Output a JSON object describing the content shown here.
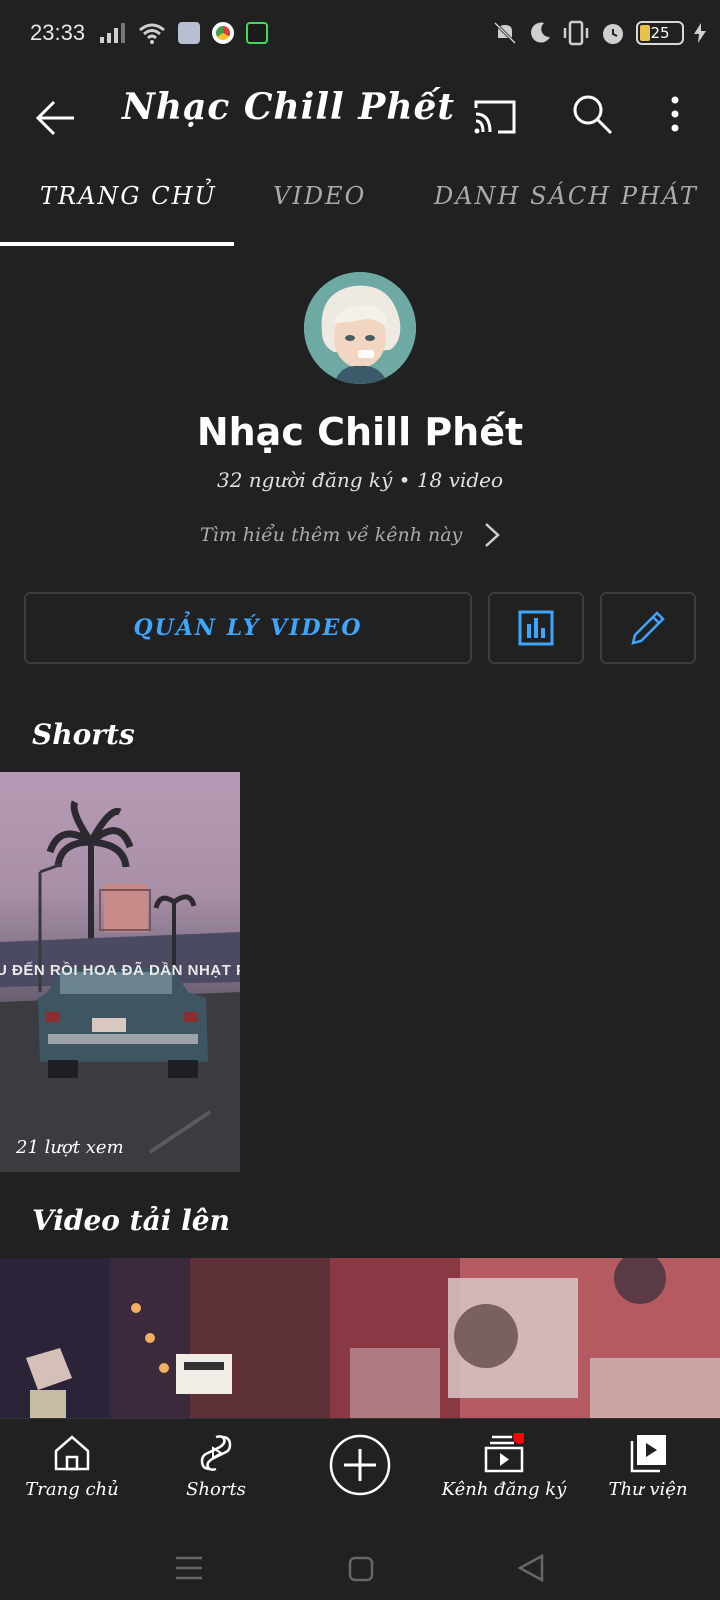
{
  "status_bar": {
    "time": "23:33",
    "battery_level": "25",
    "icons": [
      "signal-icon",
      "wifi-icon",
      "app-notification-icon",
      "chrome-icon",
      "app-icon",
      "mute-icon",
      "moon-icon",
      "vibrate-icon",
      "alarm-icon",
      "battery-icon",
      "charging-icon"
    ]
  },
  "appbar": {
    "title": "Nhạc Chill Phết"
  },
  "tabs": [
    {
      "label": "TRANG CHỦ",
      "active": true
    },
    {
      "label": "VIDEO",
      "active": false
    },
    {
      "label": "DANH SÁCH PHÁT",
      "active": false
    }
  ],
  "channel": {
    "name": "Nhạc Chill Phết",
    "stats": "32 người đăng ký • 18 video",
    "learn_more": "Tìm hiểu thêm về kênh này"
  },
  "actions": {
    "manage_label": "QUẢN LÝ VIDEO"
  },
  "shorts": {
    "title": "Shorts",
    "items": [
      {
        "views": "21 lượt xem",
        "overlay_text": "U ĐẾN RỒI HOA ĐÃ DẦN NHẠT P"
      }
    ]
  },
  "uploads": {
    "title": "Video tải lên"
  },
  "bottom_nav": [
    {
      "label": "Trang chủ",
      "icon": "home-icon"
    },
    {
      "label": "Shorts",
      "icon": "shorts-icon"
    },
    {
      "label": "",
      "icon": "create-icon"
    },
    {
      "label": "Kênh đăng ký",
      "icon": "subscriptions-icon",
      "has_badge": true
    },
    {
      "label": "Thư viện",
      "icon": "library-icon"
    }
  ],
  "colors": {
    "background": "#212121",
    "accent_blue": "#3ea6ff",
    "badge_red": "#ff0000"
  }
}
